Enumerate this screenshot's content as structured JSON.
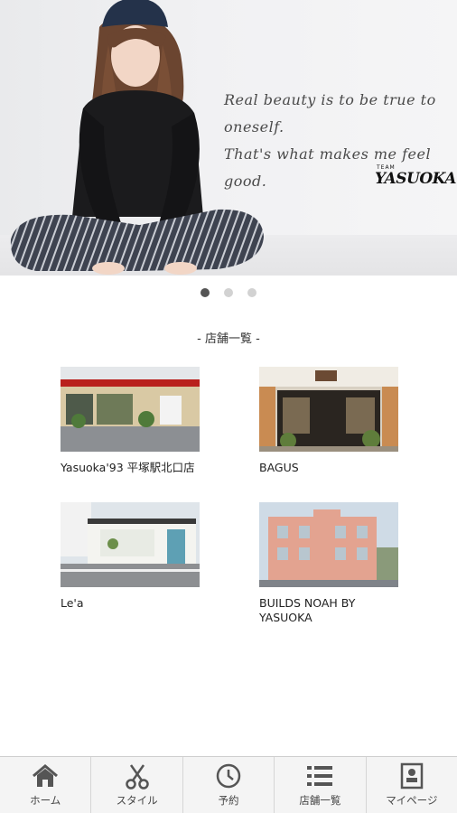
{
  "hero": {
    "tagline_line1": "Real beauty is to be true to oneself.",
    "tagline_line2": "That's what makes me feel good.",
    "logo_small": "TEAM",
    "logo_main": "YASUOKA"
  },
  "carousel": {
    "total": 3,
    "active": 1
  },
  "section": {
    "title": "- 店舗一覧 -"
  },
  "stores": [
    {
      "label": "Yasuoka'93 平塚駅北口店"
    },
    {
      "label": "BAGUS"
    },
    {
      "label": "Le'a"
    },
    {
      "label": "BUILDS NOAH BY YASUOKA"
    }
  ],
  "tabs": [
    {
      "label": "ホーム",
      "icon": "home-icon"
    },
    {
      "label": "スタイル",
      "icon": "scissors-icon"
    },
    {
      "label": "予約",
      "icon": "clock-icon"
    },
    {
      "label": "店舗一覧",
      "icon": "list-icon"
    },
    {
      "label": "マイページ",
      "icon": "profile-icon"
    }
  ]
}
